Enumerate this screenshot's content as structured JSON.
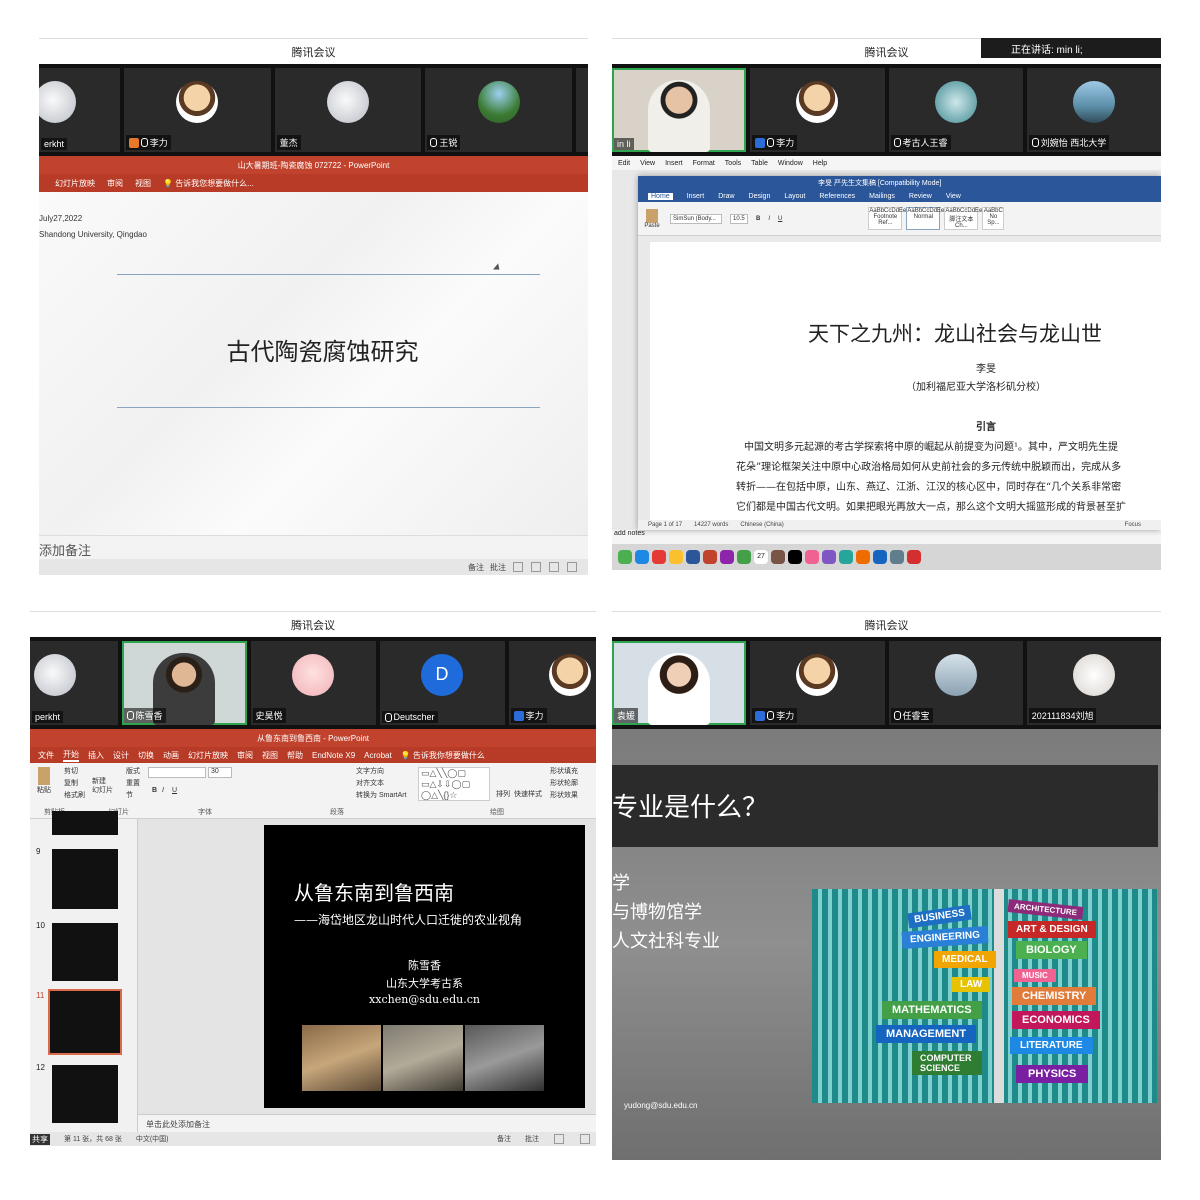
{
  "app_title": "腾讯会议",
  "panels": {
    "tl": {
      "title": "腾讯会议",
      "participants": [
        {
          "name": "erkht",
          "avatar": "grey"
        },
        {
          "name": "李力",
          "avatar": "cartoon",
          "badge": "user"
        },
        {
          "name": "董杰",
          "avatar": "grey"
        },
        {
          "name": "王锐",
          "avatar": "land"
        }
      ],
      "ppt_title": "山大暑期班-陶瓷腐蚀 072722 - PowerPoint",
      "ppt_tabs": [
        "幻灯片放映",
        "审阅",
        "视图"
      ],
      "ppt_tellme": "告诉我您想要做什么...",
      "slide_date": "July27,2022",
      "slide_place": "Shandong University, Qingdao",
      "slide_heading": "古代陶瓷腐蚀研究",
      "notes_placeholder": "添加备注",
      "status_notes": "备注",
      "status_comments": "批注"
    },
    "tr": {
      "title": "腾讯会议",
      "speaking": "正在讲话: min li;",
      "participants": [
        {
          "name": "in li",
          "avatar": "person"
        },
        {
          "name": "李力",
          "avatar": "cartoon",
          "badge": "user"
        },
        {
          "name": "考古人王睿",
          "avatar": "dragon"
        },
        {
          "name": "刘婉怡 西北大学",
          "avatar": "bridge"
        }
      ],
      "mac_menu": [
        "Edit",
        "View",
        "Insert",
        "Format",
        "Tools",
        "Table",
        "Window",
        "Help"
      ],
      "word_title": "李旻 严先生文集稿 [Compatibility Mode]",
      "word_tabs": [
        "Home",
        "Insert",
        "Draw",
        "Design",
        "Layout",
        "References",
        "Mailings",
        "Review",
        "View"
      ],
      "font_name": "SimSun (Body...",
      "font_size": "10.5",
      "paste": "Paste",
      "styles": [
        {
          "sample": "AaBbCcDdEe",
          "name": "Footnote Ref..."
        },
        {
          "sample": "AaBbCcDdEe",
          "name": "Normal"
        },
        {
          "sample": "AaBbCcDdEe",
          "name": "脚注文本 Ch..."
        },
        {
          "sample": "AaBbC",
          "name": "No Sp..."
        }
      ],
      "doc_heading": "天下之九州：龙山社会与龙山世",
      "doc_author": "李旻",
      "doc_affil": "（加利福尼亚大学洛杉矶分校）",
      "doc_section": "引言",
      "doc_lines": [
        "中国文明多元起源的考古学探索将中原的崛起从前提变为问题¹。其中，严文明先生提",
        "花朵”理论框架关注中原中心政治格局如何从史前社会的多元传统中脱颖而出，完成从多",
        "转折——在包括中原，山东、燕辽、江浙、江汉的核心区中，同时存在“几个关系非常密",
        "它们都是中国古代文明。如果把眼光再放大一点，那么这个文明大摇篮形成的背景甚至扩"
      ],
      "status_page": "Page 1 of 17",
      "status_words": "14227 words",
      "status_lang": "Chinese (China)",
      "status_focus": "Focus",
      "notes_label": "add notes",
      "dock_date": "27"
    },
    "bl": {
      "title": "腾讯会议",
      "participants": [
        {
          "name": "perkht",
          "avatar": "grey"
        },
        {
          "name": "陈雪香",
          "avatar": "person2"
        },
        {
          "name": "史昊悦",
          "avatar": "girl"
        },
        {
          "name": "Deutscher",
          "avatar": "blue",
          "letter": "D"
        },
        {
          "name": "李力",
          "avatar": "cartoon",
          "badge": "user"
        }
      ],
      "ppt_title": "从鲁东南到鲁西南 - PowerPoint",
      "ppt_tabs": [
        "文件",
        "开始",
        "插入",
        "设计",
        "切换",
        "动画",
        "幻灯片放映",
        "审阅",
        "视图",
        "帮助",
        "EndNote X9",
        "Acrobat"
      ],
      "ppt_tellme": "告诉我你想要做什么",
      "ribbon": {
        "cut": "剪切",
        "copy": "复制",
        "format_painter": "格式刷",
        "paste": "粘贴",
        "new_slide": "新建\n幻灯片",
        "layout": "版式",
        "reset": "重置",
        "section": "节",
        "text_dir": "文字方向",
        "align_text": "对齐文本",
        "smartart": "转换为 SmartArt",
        "arrange": "排列",
        "quick_styles": "快速样式",
        "shape_fill": "形状填充",
        "shape_outline": "形状轮廓",
        "shape_effect": "形状效果",
        "group_clipboard": "剪贴板",
        "group_slides": "幻灯片",
        "group_font": "字体",
        "group_paragraph": "段落",
        "group_drawing": "绘图",
        "font_size": "30"
      },
      "thumbs": [
        "9",
        "10",
        "11",
        "12"
      ],
      "slide_title": "从鲁东南到鲁西南",
      "slide_subtitle": "——海岱地区龙山时代人口迁徙的农业视角",
      "slide_author": "陈雪香",
      "slide_dept": "山东大学考古系",
      "slide_email": "xxchen@sdu.edu.cn",
      "notes_placeholder": "单击此处添加备注",
      "status_slide": "第 11 张，共 68 张",
      "status_lang": "中文(中国)",
      "status_notes": "备注",
      "status_comments": "批注",
      "share_label": "共享"
    },
    "br": {
      "title": "腾讯会议",
      "participants": [
        {
          "name": "袁媛",
          "avatar": "person3"
        },
        {
          "name": "李力",
          "avatar": "cartoon",
          "badge": "user"
        },
        {
          "name": "任睿宝",
          "avatar": "lamp"
        },
        {
          "name": "202111834刘旭",
          "avatar": "cat"
        }
      ],
      "slide_heading": "专业是什么？",
      "slide_lines": [
        "学",
        "与博物馆学",
        "人文社科专业"
      ],
      "signs": [
        "BUSINESS",
        "ARCHITECTURE",
        "ENGINEERING",
        "ART & DESIGN",
        "MEDICAL",
        "BIOLOGY",
        "LAW",
        "MUSIC",
        "CHEMISTRY",
        "MATHEMATICS",
        "ECONOMICS",
        "MANAGEMENT",
        "LITERATURE",
        "COMPUTER SCIENCE",
        "PHYSICS"
      ],
      "slide_email": "yudong@sdu.edu.cn"
    }
  }
}
